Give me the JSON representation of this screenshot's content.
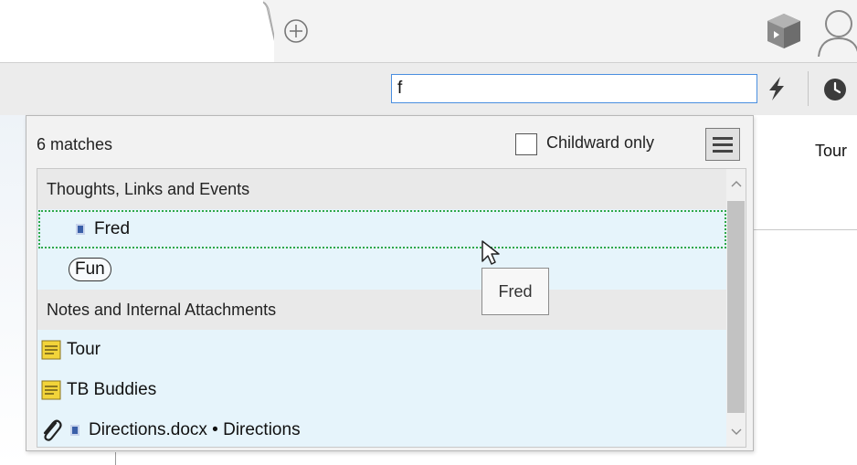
{
  "tabs": {
    "new_tab_icon": "plus-circle-icon"
  },
  "toolbar": {
    "search_value": "f",
    "icons": [
      "bolt-icon",
      "clock-icon"
    ]
  },
  "background": {
    "tour_label": "Tour"
  },
  "popup": {
    "match_count": "6 matches",
    "childward_label": "Childward only",
    "childward_checked": false,
    "groups": [
      {
        "title": "Thoughts, Links and Events",
        "items": [
          {
            "label": "Fred",
            "icon": "document-icon",
            "selected": true
          },
          {
            "label": "Fun",
            "icon": "none"
          }
        ]
      },
      {
        "title": "Notes and Internal Attachments",
        "items": [
          {
            "label": "Tour",
            "icon": "note-icon"
          },
          {
            "label": "TB Buddies",
            "icon": "note-icon"
          },
          {
            "label": "Directions.docx • Directions",
            "icon": "paperclip-icon"
          }
        ]
      }
    ],
    "tooltip": "Fred"
  },
  "colors": {
    "accent": "#4a8fe0",
    "row_highlight": "#e6f4fb",
    "selection_outline": "#2ea84a",
    "note_yellow": "#f2d43a"
  }
}
